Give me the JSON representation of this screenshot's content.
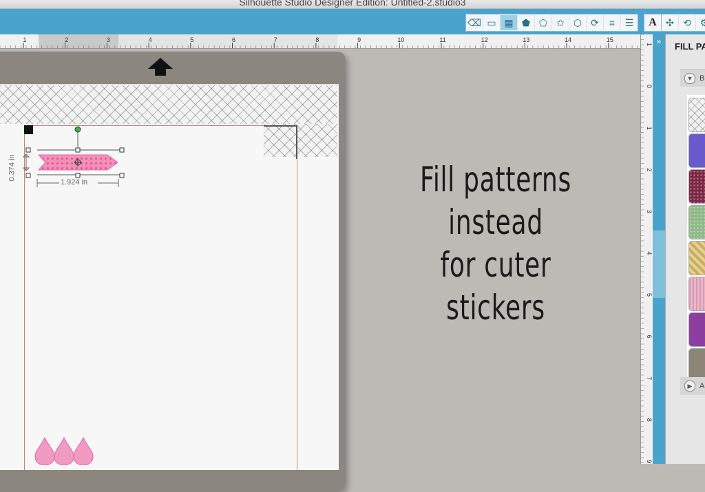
{
  "window": {
    "title": "Silhouette Studio Designer Edition: Untitled-2.studio3"
  },
  "toolbar": {
    "tools": [
      {
        "name": "eraser-tool-icon",
        "glyph": "⌫"
      },
      {
        "name": "line-style-icon",
        "glyph": "▭"
      },
      {
        "name": "fill-pattern-icon",
        "glyph": "▦",
        "active": true
      },
      {
        "name": "pentagon-icon",
        "glyph": "⬟"
      },
      {
        "name": "offset-icon",
        "glyph": "⬠"
      },
      {
        "name": "star-icon",
        "glyph": "✩"
      },
      {
        "name": "polygon-icon",
        "glyph": "⬡"
      },
      {
        "name": "knife-icon",
        "glyph": "⟳"
      },
      {
        "name": "align-icon",
        "glyph": "≡"
      },
      {
        "name": "replicate-icon",
        "glyph": "☰"
      }
    ],
    "text_tool_label": "A",
    "extra_tools": [
      {
        "name": "transform-icon",
        "glyph": "✣"
      },
      {
        "name": "rotate-icon",
        "glyph": "⟲"
      },
      {
        "name": "modify-icon",
        "glyph": "⚙"
      }
    ]
  },
  "ruler": {
    "h_labels": [
      "1",
      "2",
      "3",
      "4",
      "5",
      "6",
      "7",
      "8",
      "9",
      "10",
      "11",
      "12",
      "13",
      "14",
      "15"
    ],
    "v_labels": [
      "1",
      "0",
      "1",
      "2",
      "3",
      "4",
      "5",
      "6",
      "7",
      "8",
      "9"
    ]
  },
  "panel": {
    "title": "FILL PA",
    "section_b": "B",
    "section_a": "A",
    "collapse_label": "»"
  },
  "canvas": {
    "height_dim": "0.374 in",
    "width_dim": "1.924 in",
    "overlay_line1": "Fill patterns instead",
    "overlay_line2": "for cuter stickers"
  },
  "colors": {
    "toolbar": "#4aa3cc",
    "selection_accent": "#e06c9f",
    "sticker_pink": "#f08bb6",
    "swatches": [
      "#f0f0f0",
      "#6a5acd",
      "#7b2743",
      "#8fb889",
      "#e7d18a",
      "#e9b8c9",
      "#8d3fa0",
      "#8c8578"
    ]
  }
}
